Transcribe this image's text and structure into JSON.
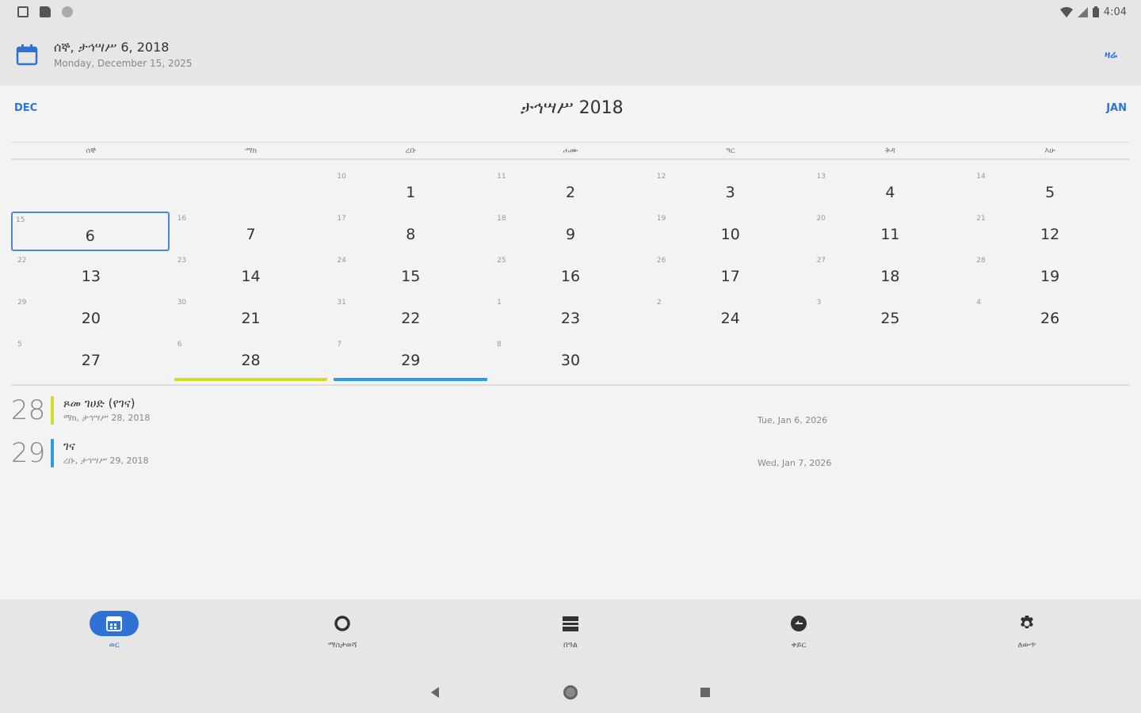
{
  "status_bar": {
    "time": "4:04"
  },
  "header": {
    "title": "ሰኞ, ታኅሣሥ 6, 2018",
    "subtitle": "Monday, December 15, 2025",
    "today_label": "ዛሬ"
  },
  "month_nav": {
    "prev_label": "DEC",
    "title": "ታኅሣሥ 2018",
    "next_label": "JAN"
  },
  "weekdays": [
    "ሰኞ",
    "ማክ",
    "ረቡ",
    "ሐሙ",
    "ዓር",
    "ቅዳ",
    "እሁ"
  ],
  "days": [
    {
      "greg": "",
      "num": ""
    },
    {
      "greg": "",
      "num": ""
    },
    {
      "greg": "10",
      "num": "1"
    },
    {
      "greg": "11",
      "num": "2"
    },
    {
      "greg": "12",
      "num": "3"
    },
    {
      "greg": "13",
      "num": "4"
    },
    {
      "greg": "14",
      "num": "5"
    },
    {
      "greg": "15",
      "num": "6",
      "selected": true
    },
    {
      "greg": "16",
      "num": "7"
    },
    {
      "greg": "17",
      "num": "8"
    },
    {
      "greg": "18",
      "num": "9"
    },
    {
      "greg": "19",
      "num": "10"
    },
    {
      "greg": "20",
      "num": "11"
    },
    {
      "greg": "21",
      "num": "12"
    },
    {
      "greg": "22",
      "num": "13"
    },
    {
      "greg": "23",
      "num": "14"
    },
    {
      "greg": "24",
      "num": "15"
    },
    {
      "greg": "25",
      "num": "16"
    },
    {
      "greg": "26",
      "num": "17"
    },
    {
      "greg": "27",
      "num": "18"
    },
    {
      "greg": "28",
      "num": "19"
    },
    {
      "greg": "29",
      "num": "20"
    },
    {
      "greg": "30",
      "num": "21"
    },
    {
      "greg": "31",
      "num": "22"
    },
    {
      "greg": "1",
      "num": "23"
    },
    {
      "greg": "2",
      "num": "24"
    },
    {
      "greg": "3",
      "num": "25"
    },
    {
      "greg": "4",
      "num": "26"
    },
    {
      "greg": "5",
      "num": "27"
    },
    {
      "greg": "6",
      "num": "28",
      "bar": "yellow"
    },
    {
      "greg": "7",
      "num": "29",
      "bar": "blue"
    },
    {
      "greg": "8",
      "num": "30"
    }
  ],
  "events": [
    {
      "day": "28",
      "color": "#d4dc2a",
      "title": "ጾመ ገሀድ (የገና)",
      "subtitle": "ማክ, ታኅሣሥ 28, 2018",
      "gregorian": "Tue, Jan 6, 2026"
    },
    {
      "day": "29",
      "color": "#2a9be6",
      "title": "ገና",
      "subtitle": "ረቡ, ታኅሣሥ 29, 2018",
      "gregorian": "Wed, Jan 7, 2026"
    }
  ],
  "bottom_nav": [
    {
      "label": "ወር",
      "icon": "calendar-icon",
      "active": true
    },
    {
      "label": "ማስታወሻ",
      "icon": "circle-icon",
      "active": false
    },
    {
      "label": "በዓል",
      "icon": "list-icon",
      "active": false
    },
    {
      "label": "ቀይር",
      "icon": "convert-icon",
      "active": false
    },
    {
      "label": "ለውጥ",
      "icon": "settings-icon",
      "active": false
    }
  ],
  "colors": {
    "accent": "#2f72d6",
    "yellow": "#d4dc2a",
    "blue": "#2a9be6"
  }
}
